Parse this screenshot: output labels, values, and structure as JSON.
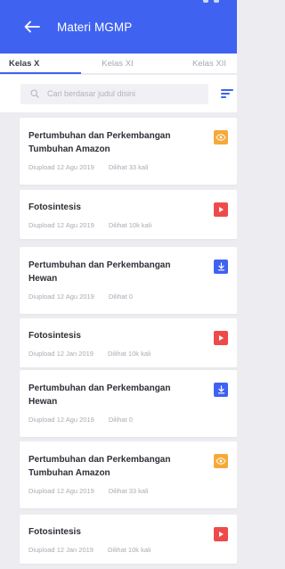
{
  "appbar": {
    "title": "Materi MGMP"
  },
  "tabs": [
    {
      "label": "Kelas X",
      "active": true
    },
    {
      "label": "Kelas XI",
      "active": false
    },
    {
      "label": "Kelas XII",
      "active": false
    }
  ],
  "search": {
    "placeholder": "Cari berdasar judul disini"
  },
  "colors": {
    "primary": "#3f63f0",
    "view_badge": "#f6a939",
    "video_badge": "#ef4a4a",
    "download_badge": "#3f63f0"
  },
  "materials": [
    {
      "title": "Pertumbuhan dan Perkembangan Tumbuhan Amazon",
      "uploaded": "Diupload 12 Agu 2019",
      "views": "Dilihat 33 kali",
      "type": "view",
      "icon": "eye-icon"
    },
    {
      "title": "Fotosintesis",
      "uploaded": "Diupload 12 Agu 2019",
      "views": "Dilihat 10k kali",
      "type": "video",
      "icon": "play-icon"
    },
    {
      "title": "Pertumbuhan dan Perkembangan Hewan",
      "uploaded": "Diupload 12 Agu 2019",
      "views": "Dilihat 0",
      "type": "download",
      "icon": "download-icon"
    },
    {
      "title": "Fotosintesis",
      "uploaded": "Diupload 12 Jan 2019",
      "views": "Dilihat 10k kali",
      "type": "video",
      "icon": "play-icon"
    },
    {
      "title": "Pertumbuhan dan Perkembangan Hewan",
      "uploaded": "Diupload 12 Agu 2019",
      "views": "Dilihat 0",
      "type": "download",
      "icon": "download-icon"
    },
    {
      "title": "Pertumbuhan dan Perkembangan Tumbuhan Amazon",
      "uploaded": "Diupload 12 Agu 2019",
      "views": "Dilihat 33 kali",
      "type": "view",
      "icon": "eye-icon"
    },
    {
      "title": "Fotosintesis",
      "uploaded": "Diupload 12 Jan 2019",
      "views": "Dilihat 10k kali",
      "type": "video",
      "icon": "play-icon"
    }
  ]
}
